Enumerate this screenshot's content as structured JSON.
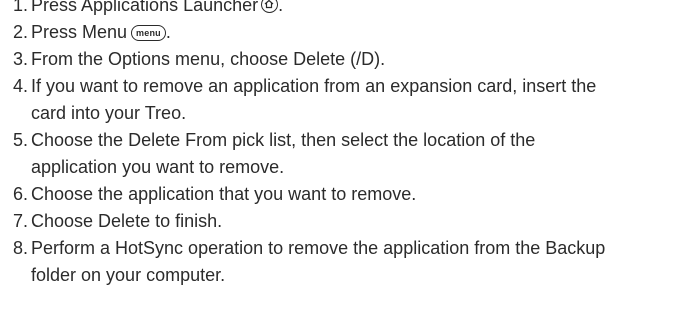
{
  "steps": [
    {
      "num": "1.",
      "text_before": "Press Applications Launcher",
      "icon": "home-button-icon",
      "text_after": "."
    },
    {
      "num": "2.",
      "text_before": "Press Menu",
      "key_label": "menu",
      "text_after": "."
    },
    {
      "num": "3.",
      "text": "From the Options menu, choose Delete (/D)."
    },
    {
      "num": "4.",
      "line1": "If you want to remove an application from an expansion card, insert the",
      "line2": "card into your Treo."
    },
    {
      "num": "5.",
      "line1": "Choose the Delete From pick list, then select the location of the",
      "line2": "application you want to remove."
    },
    {
      "num": "6.",
      "text": "Choose the application that you want to remove."
    },
    {
      "num": "7.",
      "text": "Choose Delete to finish."
    },
    {
      "num": "8.",
      "line1": "Perform a HotSync operation to remove the application from the Backup",
      "line2": "folder on your computer."
    }
  ]
}
